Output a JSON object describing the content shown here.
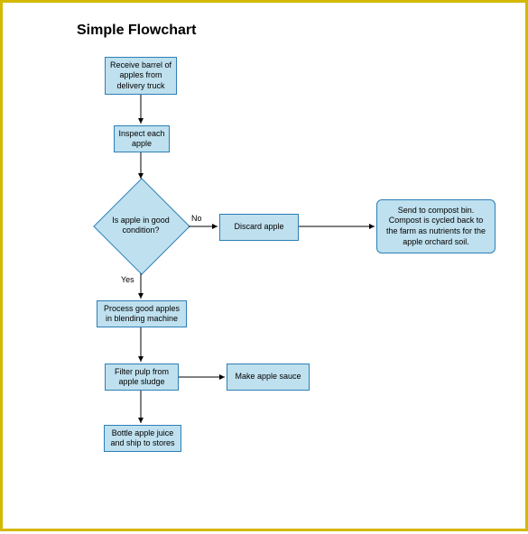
{
  "title": "Simple Flowchart",
  "nodes": {
    "receive": "Receive barrel of apples from delivery truck",
    "inspect": "Inspect each apple",
    "decision": "Is apple in good condition?",
    "discard": "Discard apple",
    "compost": "Send to compost bin. Compost is cycled back to the farm as nutrients for the apple orchard soil.",
    "process": "Process good apples in blending machine",
    "filter": "Filter pulp from apple sludge",
    "sauce": "Make apple sauce",
    "bottle": "Bottle apple juice and ship to stores"
  },
  "edges": {
    "no": "No",
    "yes": "Yes"
  }
}
